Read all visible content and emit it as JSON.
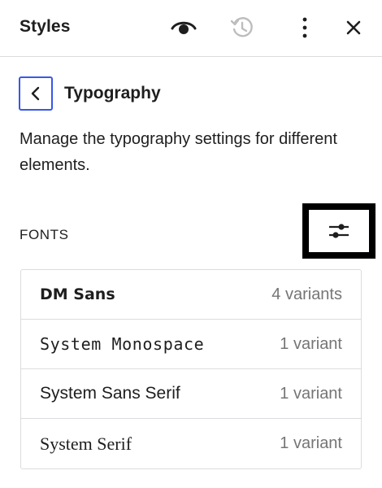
{
  "header": {
    "title": "Styles",
    "icons": [
      "eye-icon",
      "history-icon",
      "more-vertical-icon",
      "close-icon"
    ]
  },
  "panel": {
    "title": "Typography",
    "description": "Manage the typography settings for different elements."
  },
  "fonts": {
    "heading": "FONTS",
    "manage_icon": "sliders-icon",
    "items": [
      {
        "name": "DM Sans",
        "variants": "4 variants"
      },
      {
        "name": "System Monospace",
        "variants": "1 variant"
      },
      {
        "name": "System Sans Serif",
        "variants": "1 variant"
      },
      {
        "name": "System Serif",
        "variants": "1 variant"
      }
    ]
  },
  "colors": {
    "accent": "#3858e9",
    "border": "#dcdcde",
    "muted_text": "#757575"
  }
}
